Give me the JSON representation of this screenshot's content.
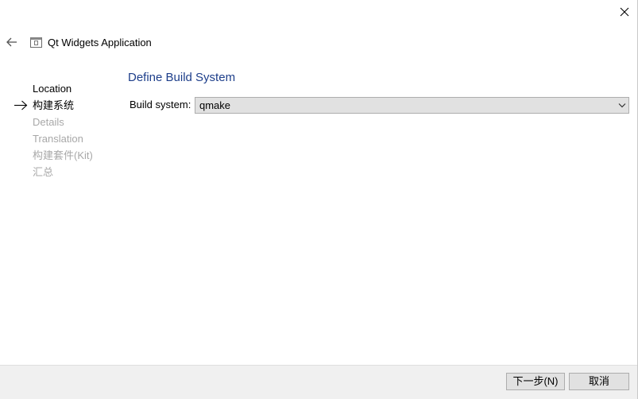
{
  "window": {
    "title": "Qt Widgets Application",
    "close_icon": "close-icon",
    "back_icon": "back-arrow-icon",
    "title_icon": "application-window-icon"
  },
  "steps": [
    {
      "label": "Location",
      "state": "done"
    },
    {
      "label": "构建系统",
      "state": "current"
    },
    {
      "label": "Details",
      "state": "pending"
    },
    {
      "label": "Translation",
      "state": "pending"
    },
    {
      "label": "构建套件(Kit)",
      "state": "pending"
    },
    {
      "label": "汇总",
      "state": "pending"
    }
  ],
  "page": {
    "heading": "Define Build System",
    "build_system_label": "Build system:",
    "build_system_value": "qmake"
  },
  "footer": {
    "next_label": "下一步(N)",
    "cancel_label": "取消"
  },
  "colors": {
    "heading": "#1d3e8a",
    "pending_step": "#a8a8a8",
    "control_bg": "#e1e1e1",
    "footer_bg": "#f0f0f0"
  }
}
